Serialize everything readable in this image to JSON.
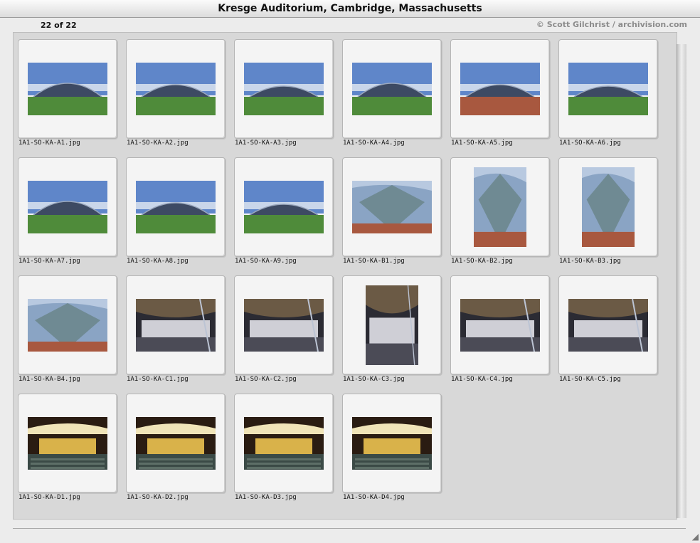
{
  "window": {
    "title": "Kresge Auditorium, Cambridge, Massachusetts"
  },
  "counter": "22 of 22",
  "credit": "© Scott Gilchrist / archivision.com",
  "thumbnails": [
    "1A1-SO-KA-A1.jpg",
    "1A1-SO-KA-A2.jpg",
    "1A1-SO-KA-A3.jpg",
    "1A1-SO-KA-A4.jpg",
    "1A1-SO-KA-A5.jpg",
    "1A1-SO-KA-A6.jpg",
    "1A1-SO-KA-A7.jpg",
    "1A1-SO-KA-A8.jpg",
    "1A1-SO-KA-A9.jpg",
    "1A1-SO-KA-B1.jpg",
    "1A1-SO-KA-B2.jpg",
    "1A1-SO-KA-B3.jpg",
    "1A1-SO-KA-B4.jpg",
    "1A1-SO-KA-C1.jpg",
    "1A1-SO-KA-C2.jpg",
    "1A1-SO-KA-C3.jpg",
    "1A1-SO-KA-C4.jpg",
    "1A1-SO-KA-C5.jpg",
    "1A1-SO-KA-D1.jpg",
    "1A1-SO-KA-D2.jpg",
    "1A1-SO-KA-D3.jpg",
    "1A1-SO-KA-D4.jpg"
  ],
  "colors": {
    "sky": "#5f86c9",
    "grass": "#4f8b3a",
    "brick": "#a8583f",
    "glass": "#3d4a63",
    "interior": "#d9b24a"
  }
}
